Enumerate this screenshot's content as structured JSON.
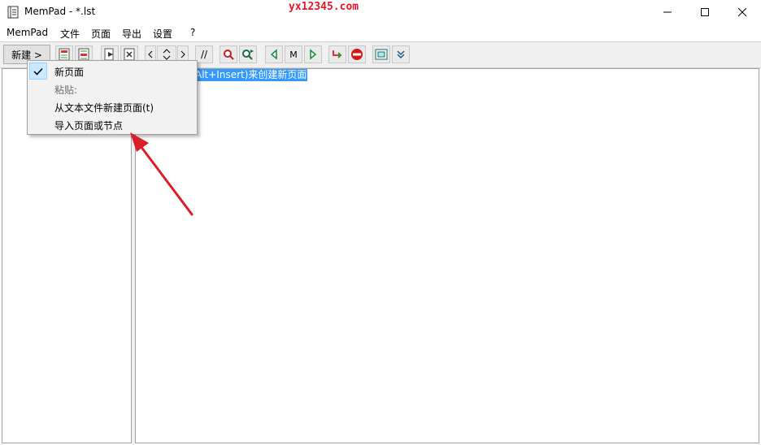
{
  "window": {
    "title": "MemPad - *.lst",
    "watermark": "yx12345.com"
  },
  "menubar": {
    "items": [
      "MemPad",
      "文件",
      "页面",
      "导出",
      "设置",
      "?"
    ]
  },
  "toolbar": {
    "new_label": "新建 >",
    "comment_label": "//",
    "m_label": "M"
  },
  "editor": {
    "hint_text": "Alt+Insert)来创建新页面"
  },
  "popup": {
    "items": [
      {
        "label": "新页面",
        "checked": true,
        "disabled": false
      },
      {
        "label": "粘贴:",
        "checked": false,
        "disabled": true
      },
      {
        "label": "从文本文件新建页面(t)",
        "checked": false,
        "disabled": false
      },
      {
        "label": "导入页面或节点",
        "checked": false,
        "disabled": false
      }
    ]
  },
  "colors": {
    "selection": "#3399ff",
    "arrow": "#d9202a",
    "watermark": "#e8162a"
  }
}
